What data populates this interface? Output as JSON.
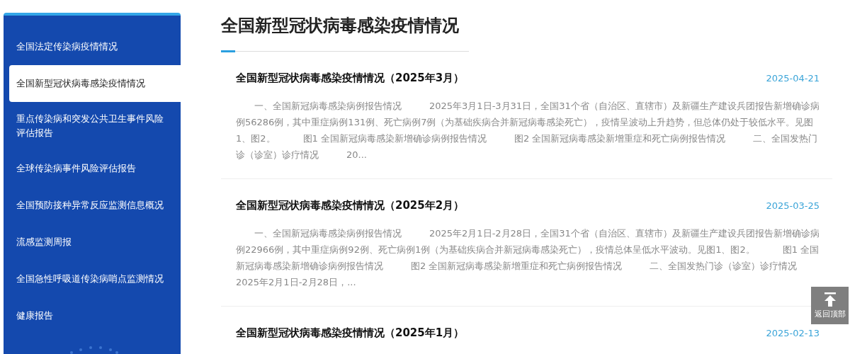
{
  "sidebar": {
    "items": [
      {
        "label": "全国法定传染病疫情情况",
        "selected": false
      },
      {
        "label": "全国新型冠状病毒感染疫情情况",
        "selected": true
      },
      {
        "label": "重点传染病和突发公共卫生事件风险评估报告",
        "selected": false
      },
      {
        "label": "全球传染病事件风险评估报告",
        "selected": false
      },
      {
        "label": "全国预防接种异常反应监测信息概况",
        "selected": false
      },
      {
        "label": "流感监测周报",
        "selected": false
      },
      {
        "label": "全国急性呼吸道传染病哨点监测情况",
        "selected": false
      },
      {
        "label": "健康报告",
        "selected": false
      }
    ]
  },
  "page_title": "全国新型冠状病毒感染疫情情况",
  "articles": [
    {
      "title": "全国新型冠状病毒感染疫情情况（2025年3月）",
      "date": "2025-04-21",
      "summary": "一、全国新冠病毒感染病例报告情况　　　2025年3月1日-3月31日，全国31个省（自治区、直辖市）及新疆生产建设兵团报告新增确诊病例56286例，其中重症病例131例、死亡病例7例（为基础疾病合并新冠病毒感染死亡），疫情呈波动上升趋势，但总体仍处于较低水平。见图1、图2。　　　图1 全国新冠病毒感染新增确诊病例报告情况　　　图2 全国新冠病毒感染新增重症和死亡病例报告情况　　　二、全国发热门诊（诊室）诊疗情况　　　20..."
    },
    {
      "title": "全国新型冠状病毒感染疫情情况（2025年2月）",
      "date": "2025-03-25",
      "summary": "一、全国新冠病毒感染病例报告情况　　　2025年2月1日-2月28日，全国31个省（自治区、直辖市）及新疆生产建设兵团报告新增确诊病例22966例，其中重症病例92例、死亡病例1例（为基础疾病合并新冠病毒感染死亡），疫情总体呈低水平波动。见图1、图2。　　　图1 全国新冠病毒感染新增确诊病例报告情况　　　图2 全国新冠病毒感染新增重症和死亡病例报告情况　　　二、全国发热门诊（诊室）诊疗情况　　　2025年2月1日-2月28日，..."
    },
    {
      "title": "全国新型冠状病毒感染疫情情况（2025年1月）",
      "date": "2025-02-13"
    }
  ],
  "back_to_top": "返回顶部"
}
